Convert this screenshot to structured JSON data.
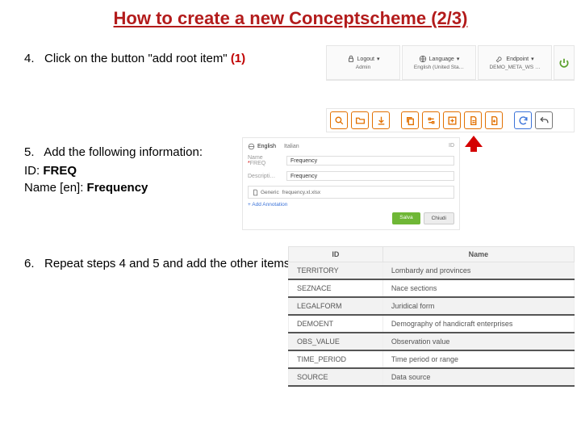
{
  "title": "How to create a new Conceptscheme (2/3)",
  "steps": {
    "s4": {
      "num": "4.",
      "text": "Click on the button \"add root item\"",
      "ref": "(1)"
    },
    "s5": {
      "num": "5.",
      "text": "Add the following information:",
      "idlabel": "ID:",
      "idval": "FREQ",
      "namelabel": "Name [en]:",
      "nameval": "Frequency"
    },
    "s6": {
      "num": "6.",
      "text": "Repeat steps 4 and 5 and add the other items"
    }
  },
  "anno1": "(1)",
  "header": {
    "logout": {
      "label": "Logout",
      "sub": "Admin"
    },
    "lang": {
      "label": "Language",
      "sub": "English (United Sta…"
    },
    "endpoint": {
      "label": "Endpoint",
      "sub": "DEMO_META_WS …"
    }
  },
  "form": {
    "tabs": {
      "en": "English",
      "it": "Italian"
    },
    "id_label": "ID",
    "name_label": "Name",
    "name_prefix": "FREQ",
    "name_value": "Frequency",
    "desc_label_prefix": "Descripti…",
    "desc_value": "Frequency",
    "generic_label": "Generic",
    "generic_value": "frequency.xl.xlsx",
    "add_anno": "+ Add Annotation",
    "save": "Salva",
    "cancel": "Chiudi"
  },
  "table": {
    "headers": {
      "id": "ID",
      "name": "Name"
    },
    "rows": [
      {
        "id": "TERRITORY",
        "name": "Lombardy and provinces"
      },
      {
        "id": "SEZNACE",
        "name": "Nace sections"
      },
      {
        "id": "LEGALFORM",
        "name": "Juridical form"
      },
      {
        "id": "DEMOENT",
        "name": "Demography of handicraft enterprises"
      },
      {
        "id": "OBS_VALUE",
        "name": "Observation value"
      },
      {
        "id": "TIME_PERIOD",
        "name": "Time period or range"
      },
      {
        "id": "SOURCE",
        "name": "Data source"
      }
    ]
  }
}
